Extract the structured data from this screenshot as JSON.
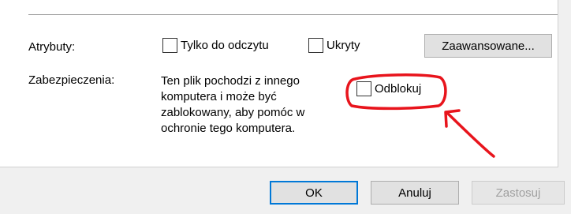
{
  "attributes": {
    "label": "Atrybuty:",
    "read_only": {
      "label": "Tylko do odczytu",
      "checked": false
    },
    "hidden": {
      "label": "Ukryty",
      "checked": false
    },
    "advanced_button": "Zaawansowane..."
  },
  "security": {
    "label": "Zabezpieczenia:",
    "message_lines": [
      "Ten plik pochodzi z innego",
      "komputera i może być",
      "zablokowany, aby pomóc w",
      "ochronie tego komputera."
    ],
    "unblock": {
      "label": "Odblokuj",
      "checked": false
    }
  },
  "buttons": {
    "ok": "OK",
    "cancel": "Anuluj",
    "apply": "Zastosuj"
  },
  "annotation": {
    "color": "#e8141c"
  }
}
